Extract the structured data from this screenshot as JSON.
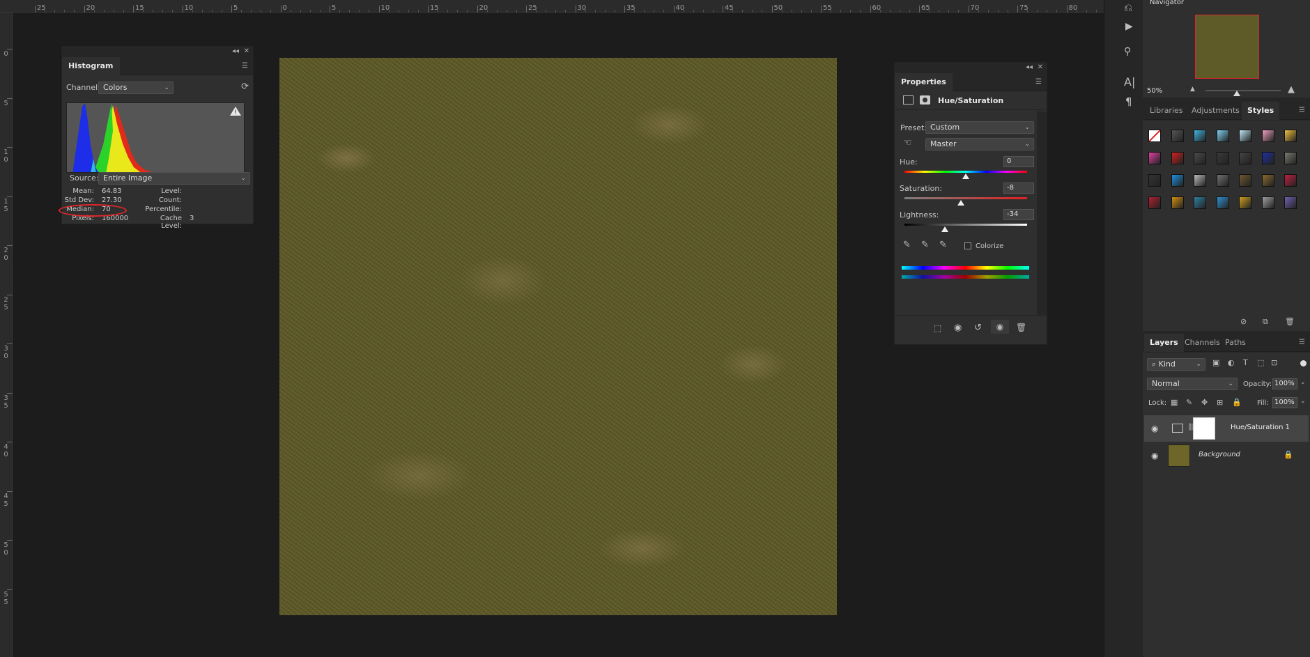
{
  "ruler_top_labels": [
    "25",
    "20",
    "15",
    "10",
    "5",
    "0",
    "5",
    "10",
    "15",
    "20",
    "25",
    "30",
    "35",
    "40",
    "45",
    "50",
    "55",
    "60",
    "65",
    "70",
    "75",
    "80"
  ],
  "ruler_left_labels": [
    "0",
    "5",
    "10",
    "15",
    "20",
    "25",
    "30",
    "35",
    "40",
    "45",
    "50",
    "55"
  ],
  "histogram": {
    "tab": "Histogram",
    "channel_label": "Channel:",
    "channel_value": "Colors",
    "source_label": "Source:",
    "source_value": "Entire Image",
    "stats_left": [
      {
        "label": "Mean:",
        "value": "64.83"
      },
      {
        "label": "Std Dev:",
        "value": "27.30"
      },
      {
        "label": "Median:",
        "value": "70"
      },
      {
        "label": "Pixels:",
        "value": "160000"
      }
    ],
    "stats_right": [
      {
        "label": "Level:",
        "value": ""
      },
      {
        "label": "Count:",
        "value": ""
      },
      {
        "label": "Percentile:",
        "value": ""
      },
      {
        "label": "Cache Level:",
        "value": "3"
      }
    ],
    "highlight_color": "#e0262a"
  },
  "properties": {
    "tab": "Properties",
    "title": "Hue/Saturation",
    "preset_label": "Preset:",
    "preset_value": "Custom",
    "range_value": "Master",
    "hue_label": "Hue:",
    "hue_value": "0",
    "saturation_label": "Saturation:",
    "saturation_value": "-8",
    "lightness_label": "Lightness:",
    "lightness_value": "-34",
    "colorize_label": "Colorize",
    "hue_thumb": 0.5,
    "saturation_thumb": 0.46,
    "lightness_thumb": 0.33
  },
  "navigator": {
    "title": "Navigator",
    "zoom": "50%",
    "view_box_color": "#e0262a"
  },
  "styles_panel": {
    "tabs": [
      "Libraries",
      "Adjustments",
      "Styles"
    ],
    "active_tab": "Styles",
    "swatches": [
      "#ffffff",
      "#555555",
      "#3fb6e0",
      "#7fd0f0",
      "#c0e8f8",
      "#f0a0c0",
      "#f0c040",
      "#e040a0",
      "#d02020",
      "#4a4a4a",
      "#3a3a3a",
      "#444444",
      "#2030a0",
      "#7a7a70",
      "#333333",
      "#1e90e0",
      "#bbbbbb",
      "#707070",
      "#6e5a30",
      "#8a6a30",
      "#c02040",
      "#b02030",
      "#d09010",
      "#3080a0",
      "#3090d0",
      "#d0a020",
      "#a0a0a0",
      "#7060b0"
    ]
  },
  "layers_panel": {
    "tabs": [
      "Layers",
      "Channels",
      "Paths"
    ],
    "active_tab": "Layers",
    "kind_value": "Kind",
    "blend_mode": "Normal",
    "opacity_label": "Opacity:",
    "opacity_value": "100%",
    "lock_label": "Lock:",
    "fill_label": "Fill:",
    "fill_value": "100%",
    "layers": [
      {
        "name": "Hue/Saturation 1",
        "selected": true
      },
      {
        "name": "Background",
        "selected": false
      }
    ]
  }
}
